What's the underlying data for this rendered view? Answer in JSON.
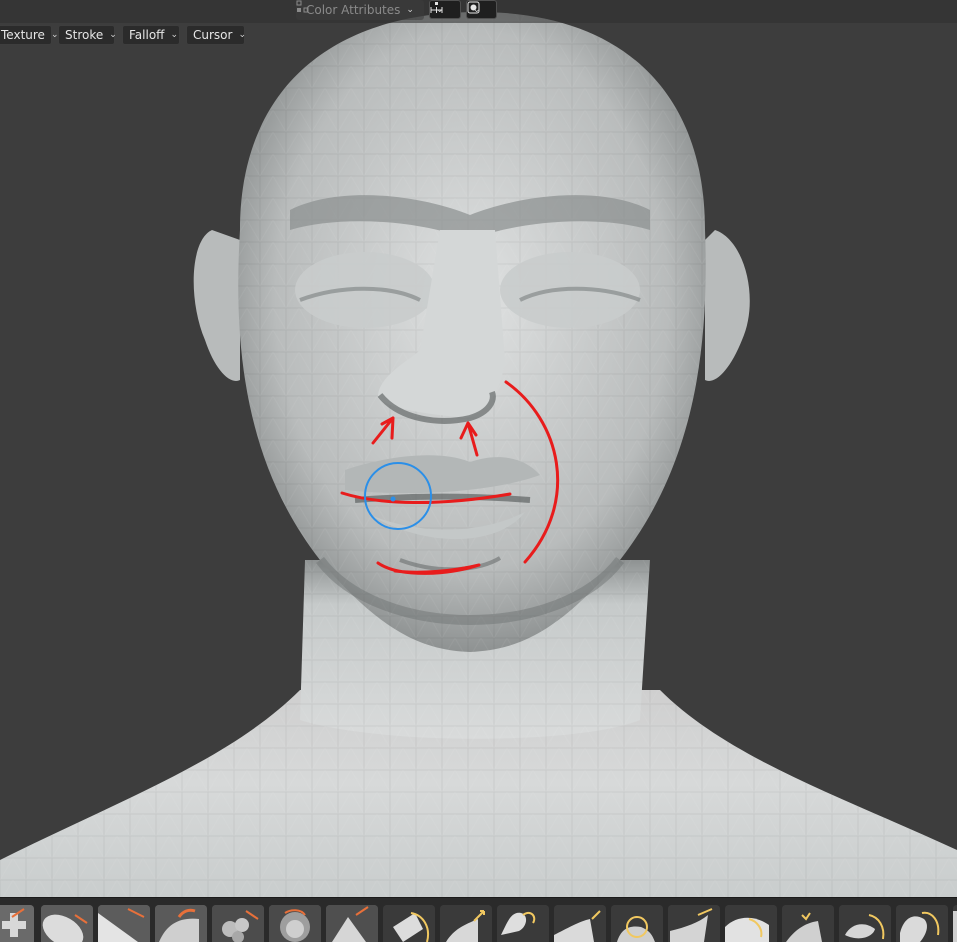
{
  "header": {
    "color_attributes_label": "Color Attributes",
    "icons": [
      "vertex-group-icon",
      "symmetry-icon",
      "brush-circle-icon"
    ]
  },
  "tool_settings": {
    "texture_label": "Texture",
    "stroke_label": "Stroke",
    "falloff_label": "Falloff",
    "cursor_label": "Cursor"
  },
  "colors": {
    "viewport_bg": "#3d3d3d",
    "annotation_stroke": "#e81c1c",
    "brush_cursor": "#2b8fe8",
    "accent_orange": "#e8703a",
    "accent_yellow": "#f1c860"
  },
  "brush_shelf": {
    "brushes": [
      "draw-brush-icon",
      "clay-brush-icon",
      "clay-strips-brush-icon",
      "layer-brush-icon",
      "inflate-brush-icon",
      "blob-brush-icon",
      "crease-brush-icon",
      "smooth-brush-icon",
      "flatten-brush-icon",
      "grab-brush-icon",
      "snake-hook-brush-icon",
      "thumb-brush-icon",
      "pose-brush-icon",
      "nudge-brush-icon",
      "rotate-brush-icon",
      "slide-relax-brush-icon",
      "boundary-brush-icon",
      "cloth-brush-icon"
    ]
  }
}
